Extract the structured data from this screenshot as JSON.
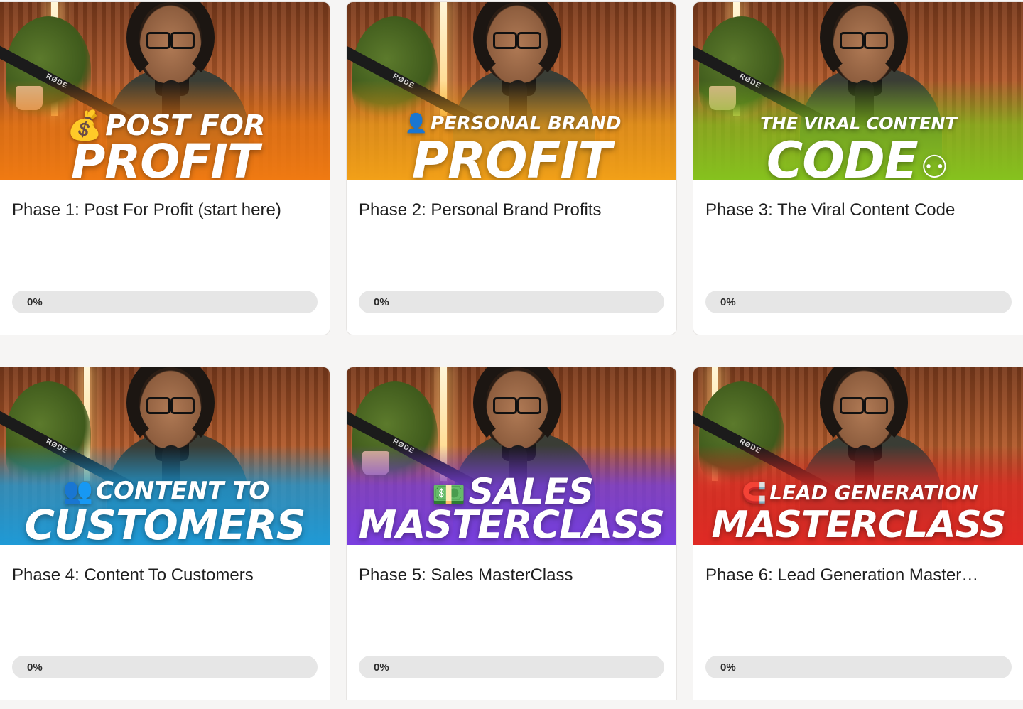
{
  "courses": [
    {
      "thumb_line1": "POST FOR",
      "thumb_line2": "PROFIT",
      "thumb_icon": "money-bag-icon",
      "accent": "#f07a12",
      "title": "Phase 1: Post For Profit (start here)",
      "progress_label": "0%",
      "progress": 0
    },
    {
      "thumb_line1": "PERSONAL BRAND",
      "thumb_line2": "PROFIT",
      "thumb_icon": "person-icon",
      "accent": "#f2a018",
      "title": "Phase 2: Personal Brand Profits",
      "progress_label": "0%",
      "progress": 0
    },
    {
      "thumb_line1": "THE VIRAL CONTENT",
      "thumb_line2": "CODE",
      "thumb_icon": "viral-network-icon",
      "accent": "#86c21e",
      "title": "Phase 3: The Viral Content Code",
      "progress_label": "0%",
      "progress": 0
    },
    {
      "thumb_line1": "CONTENT TO",
      "thumb_line2": "CUSTOMERS",
      "thumb_icon": "people-icon",
      "accent": "#1f9ad6",
      "title": "Phase 4: Content To Customers",
      "progress_label": "0%",
      "progress": 0
    },
    {
      "thumb_line1": "SALES",
      "thumb_line2": "MASTERCLASS",
      "thumb_icon": "dollar-bill-icon",
      "accent": "#7a3fe0",
      "title": "Phase 5: Sales MasterClass",
      "progress_label": "0%",
      "progress": 0
    },
    {
      "thumb_line1": "LEAD GENERATION",
      "thumb_line2": "MASTERCLASS",
      "thumb_icon": "magnet-icon",
      "accent": "#e02a24",
      "title": "Phase 6: Lead Generation Master…",
      "progress_label": "0%",
      "progress": 0
    }
  ]
}
